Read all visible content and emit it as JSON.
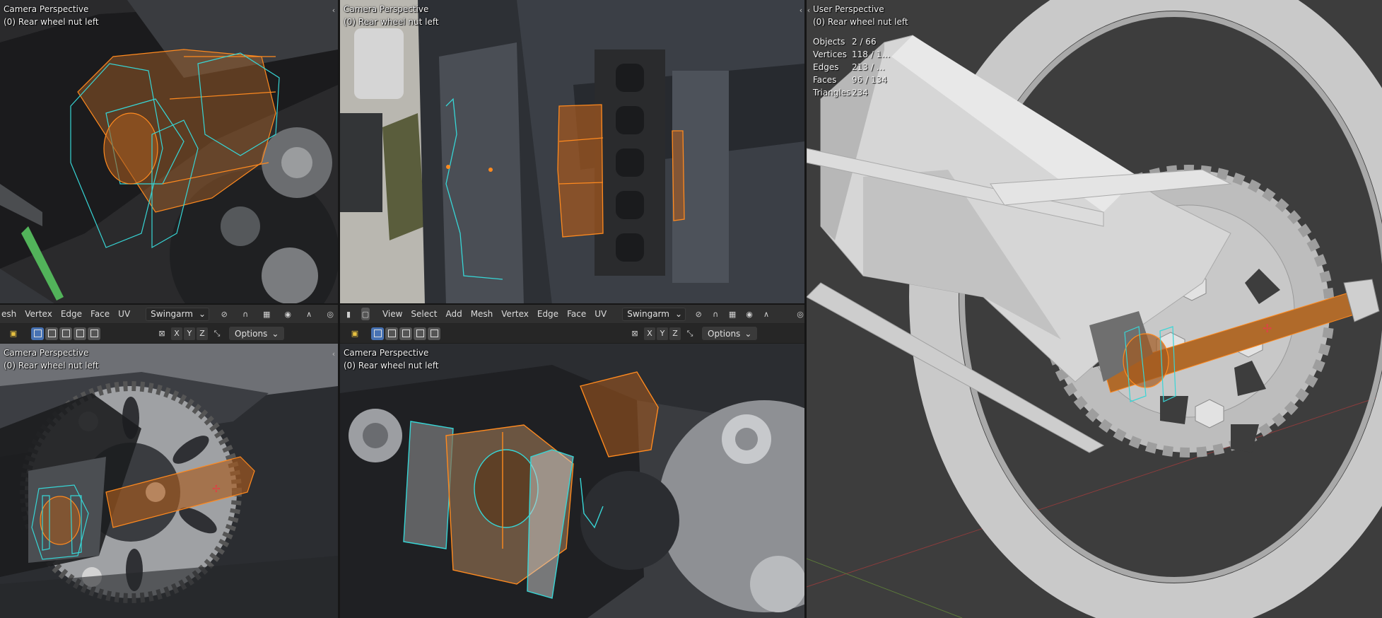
{
  "viewports": {
    "top_left": {
      "title": "Camera Perspective",
      "object": "(0) Rear wheel nut left"
    },
    "top_middle": {
      "title": "Camera Perspective",
      "object": "(0) Rear wheel nut left"
    },
    "bottom_left": {
      "title": "Camera Perspective",
      "object": "(0) Rear wheel nut left"
    },
    "bottom_middle": {
      "title": "Camera Perspective",
      "object": "(0) Rear wheel nut left"
    },
    "right": {
      "title": "User Perspective",
      "object": "(0) Rear wheel nut left",
      "stats": [
        {
          "label": "Objects",
          "value": "2 / 66"
        },
        {
          "label": "Vertices",
          "value": "118 / 1…"
        },
        {
          "label": "Edges",
          "value": "213 / …"
        },
        {
          "label": "Faces",
          "value": "96 / 134"
        },
        {
          "label": "Triangles",
          "value": "234"
        }
      ]
    }
  },
  "header_left": {
    "menus": [
      "esh",
      "Vertex",
      "Edge",
      "Face",
      "UV"
    ],
    "object_dropdown": "Swingarm"
  },
  "header_middle": {
    "menus": [
      "View",
      "Select",
      "Add",
      "Mesh",
      "Vertex",
      "Edge",
      "Face",
      "UV"
    ],
    "object_dropdown": "Swingarm"
  },
  "tool_header": {
    "axes": [
      "X",
      "Y",
      "Z"
    ],
    "options_label": "Options"
  },
  "colors": {
    "selected_edge": "#ff8a1f",
    "active_object_edge": "#37d6d6",
    "header_bg": "#303030",
    "viewport_grey": "#3d3d3d"
  }
}
